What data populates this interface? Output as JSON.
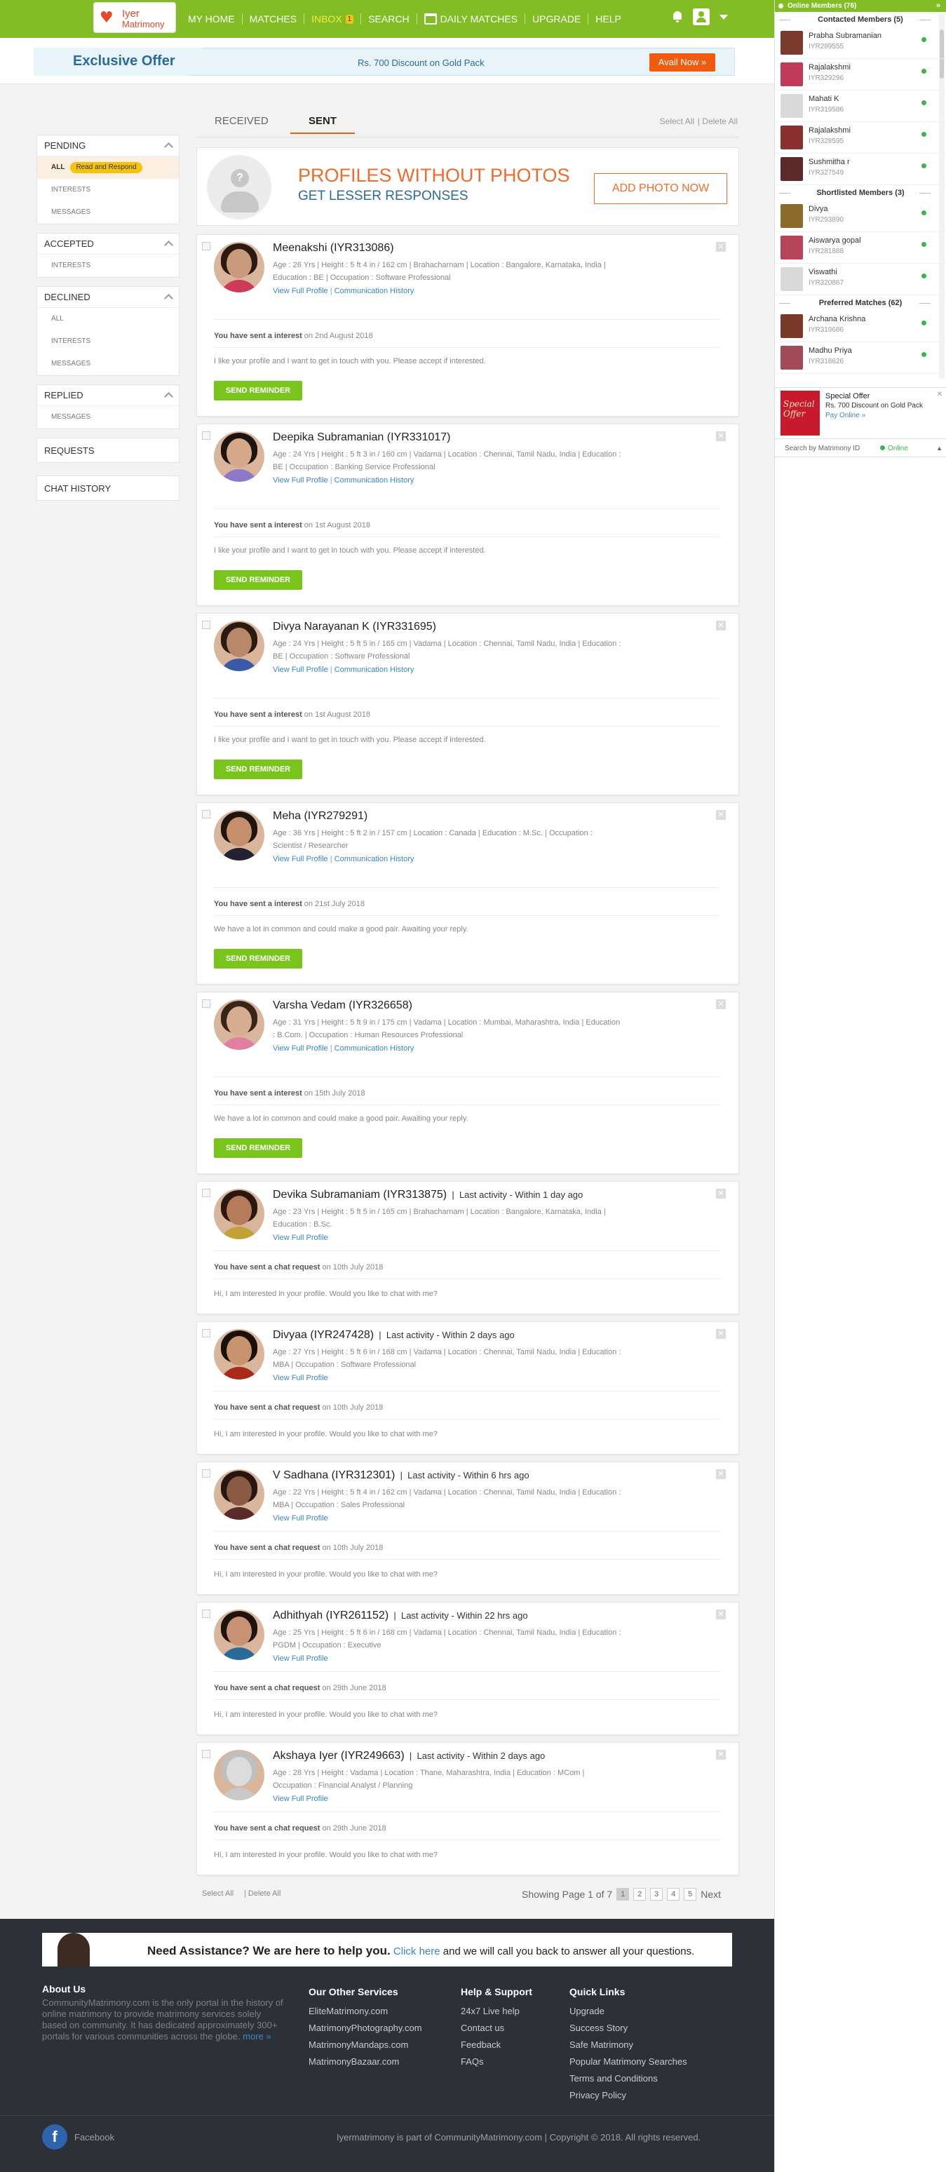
{
  "brand": {
    "line1": "Iyer",
    "line2": "Matrimony"
  },
  "nav": [
    {
      "label": "MY HOME"
    },
    {
      "label": "MATCHES"
    },
    {
      "label": "INBOX",
      "badge": "1"
    },
    {
      "label": "SEARCH"
    },
    {
      "label": "DAILY MATCHES"
    },
    {
      "label": "UPGRADE"
    },
    {
      "label": "HELP"
    }
  ],
  "offer": {
    "title": "Exclusive Offer",
    "text": "Rs. 700 Discount on Gold Pack",
    "button": "Avail Now »"
  },
  "tabs": {
    "received": "RECEIVED",
    "sent": "SENT",
    "select_all": "Select All",
    "delete_all": "| Delete All"
  },
  "sidebar": {
    "pending": {
      "title": "PENDING",
      "all": "ALL",
      "pill": "Read and Respond",
      "interests": "INTERESTS",
      "messages": "MESSAGES"
    },
    "accepted": {
      "title": "ACCEPTED",
      "interests": "INTERESTS"
    },
    "declined": {
      "title": "DECLINED",
      "all": "ALL",
      "interests": "INTERESTS",
      "messages": "MESSAGES"
    },
    "replied": {
      "title": "REPLIED",
      "messages": "MESSAGES"
    },
    "requests": "REQUESTS",
    "chat_history": "CHAT HISTORY"
  },
  "nophoto": {
    "headline": "PROFILES WITHOUT PHOTOS",
    "sub": "GET LESSER RESPONSES",
    "button": "ADD PHOTO NOW"
  },
  "cards": [
    {
      "name": "Meenakshi (IYR313086)",
      "activity": "",
      "details": "Age : 26 Yrs | Height : 5 ft 4 in / 162 cm | Brahacharnam | Location : Bangalore, Karnataka, India | Education : BE | Occupation : Software Professional",
      "links": "View Full Profile",
      "links2": "Communication History",
      "sent_label": "You have sent a interest",
      "sent_date": " on 2nd August 2018",
      "message": "I like your profile and I want to get in touch with you. Please accept if interested.",
      "button": "SEND REMINDER"
    },
    {
      "name": "Deepika Subramanian (IYR331017)",
      "activity": "",
      "details": "Age : 24 Yrs | Height : 5 ft 3 in / 160 cm | Vadama | Location : Chennai, Tamil Nadu, India | Education : BE | Occupation : Banking Service Professional",
      "links": "View Full Profile",
      "links2": "Communication History",
      "sent_label": "You have sent a interest",
      "sent_date": " on 1st August 2018",
      "message": "I like your profile and I want to get in touch with you. Please accept if interested.",
      "button": "SEND REMINDER"
    },
    {
      "name": "Divya Narayanan K (IYR331695)",
      "activity": "",
      "details": "Age : 24 Yrs | Height : 5 ft 5 in / 165 cm | Vadama | Location : Chennai, Tamil Nadu, India | Education : BE | Occupation : Software Professional",
      "links": "View Full Profile",
      "links2": "Communication History",
      "sent_label": "You have sent a interest",
      "sent_date": " on 1st August 2018",
      "message": "I like your profile and I want to get in touch with you. Please accept if interested.",
      "button": "SEND REMINDER"
    },
    {
      "name": "Meha (IYR279291)",
      "activity": "",
      "details": "Age : 36 Yrs | Height : 5 ft 2 in / 157 cm | Location : Canada | Education : M.Sc. | Occupation : Scientist / Researcher",
      "links": "View Full Profile",
      "links2": "Communication History",
      "sent_label": "You have sent a interest",
      "sent_date": " on 21st July 2018",
      "message": "We have a lot in common and could make a good pair. Awaiting your reply.",
      "button": "SEND REMINDER"
    },
    {
      "name": "Varsha Vedam (IYR326658)",
      "activity": "",
      "details": "Age : 31 Yrs | Height : 5 ft 9 in / 175 cm | Vadama | Location : Mumbai, Maharashtra, India | Education : B.Com. | Occupation : Human Resources Professional",
      "links": "View Full Profile",
      "links2": "Communication History",
      "sent_label": "You have sent a interest",
      "sent_date": " on 15th July 2018",
      "message": "We have a lot in common and could make a good pair. Awaiting your reply.",
      "button": "SEND REMINDER"
    },
    {
      "name": "Devika Subramaniam (IYR313875)",
      "activity": "Last activity - Within 1 day ago",
      "details": "Age : 23 Yrs | Height : 5 ft 5 in / 165 cm | Brahacharnam | Location : Bangalore, Karnataka, India | Education : B.Sc.",
      "links": "View Full Profile",
      "links2": "",
      "sent_label": "You have sent a chat request",
      "sent_date": " on 10th July 2018",
      "message": "Hi, I am interested in your profile. Would you like to chat with me?",
      "button": ""
    },
    {
      "name": "Divyaa (IYR247428)",
      "activity": "Last activity - Within 2 days ago",
      "details": "Age : 27 Yrs | Height : 5 ft 6 in / 168 cm | Vadama | Location : Chennai, Tamil Nadu, India | Education : MBA | Occupation : Software Professional",
      "links": "View Full Profile",
      "links2": "",
      "sent_label": "You have sent a chat request",
      "sent_date": " on 10th July 2018",
      "message": "Hi, I am interested in your profile. Would you like to chat with me?",
      "button": ""
    },
    {
      "name": "V Sadhana (IYR312301)",
      "activity": "Last activity - Within 6 hrs ago",
      "details": "Age : 22 Yrs | Height : 5 ft 4 in / 162 cm | Vadama | Location : Chennai, Tamil Nadu, India | Education : MBA | Occupation : Sales Professional",
      "links": "View Full Profile",
      "links2": "",
      "sent_label": "You have sent a chat request",
      "sent_date": " on 10th July 2018",
      "message": "Hi, I am interested in your profile. Would you like to chat with me?",
      "button": ""
    },
    {
      "name": "Adhithyah (IYR261152)",
      "activity": "Last activity - Within 22 hrs ago",
      "details": "Age : 25 Yrs | Height : 5 ft 6 in / 168 cm | Vadama | Location : Chennai, Tamil Nadu, India | Education : PGDM | Occupation : Executive",
      "links": "View Full Profile",
      "links2": "",
      "sent_label": "You have sent a chat request",
      "sent_date": " on 29th June 2018",
      "message": "Hi, I am interested in your profile. Would you like to chat with me?",
      "button": ""
    },
    {
      "name": "Akshaya Iyer (IYR249663)",
      "activity": "Last activity - Within 2 days ago",
      "details": "Age : 28 Yrs | Height : Vadama | Location : Thane, Maharashtra, India | Education : MCom | Occupation : Financial Analyst / Planning",
      "links": "View Full Profile",
      "links2": "",
      "sent_label": "You have sent a chat request",
      "sent_date": " on 29th June 2018",
      "message": "Hi, I am interested in your profile. Would you like to chat with me?",
      "button": ""
    }
  ],
  "pagination": {
    "select_all": "Select All",
    "delete_all": "| Delete All",
    "showing": "Showing Page 1 of 7",
    "pages": [
      "1",
      "2",
      "3",
      "4",
      "5"
    ],
    "next": "Next"
  },
  "assist": {
    "title": "Need Assistance? We are here to help you.",
    "click": "Click here",
    "rest": " and we will call you back to answer all your questions."
  },
  "footer": {
    "about_title": "About Us",
    "about_text": "CommunityMatrimony.com is the only portal in the history of online matrimony to provide matrimony services solely based on community. It has dedicated approximately 300+ portals for various communities across the globe.",
    "more": "more »",
    "services_title": "Our Other Services",
    "services": [
      "EliteMatrimony.com",
      "MatrimonyPhotography.com",
      "MatrimonyMandaps.com",
      "MatrimonyBazaar.com"
    ],
    "help_title": "Help & Support",
    "help": [
      "24x7 Live help",
      "Contact us",
      "Feedback",
      "FAQs"
    ],
    "quick_title": "Quick Links",
    "quick": [
      "Upgrade",
      "Success Story",
      "Safe Matrimony",
      "Popular Matrimony Searches",
      "Terms and Conditions",
      "Privacy Policy"
    ],
    "facebook": "Facebook",
    "copyright": "Iyermatrimony is part of CommunityMatrimony.com | Copyright © 2018. All rights reserved."
  },
  "online": {
    "header": "Online Members (76)",
    "contacted_title": "Contacted Members (5)",
    "contacted": [
      {
        "name": "Prabha Subramanian",
        "id": "IYR289555"
      },
      {
        "name": "Rajalakshmi",
        "id": "IYR329296"
      },
      {
        "name": "Mahati K",
        "id": "IYR319586"
      },
      {
        "name": "Rajalakshmi",
        "id": "IYR328595"
      },
      {
        "name": "Sushmitha r",
        "id": "IYR327549"
      }
    ],
    "shortlisted_title": "Shortlisted Members (3)",
    "shortlisted": [
      {
        "name": "Divya",
        "id": "IYR293890"
      },
      {
        "name": "Aiswarya gopal",
        "id": "IYR281888"
      },
      {
        "name": "Viswathi",
        "id": "IYR320867"
      }
    ],
    "preferred_title": "Preferred Matches (62)",
    "preferred": [
      {
        "name": "Archana Krishna",
        "id": "IYR319686"
      },
      {
        "name": "Madhu Priya",
        "id": "IYR318626"
      }
    ],
    "special_title": "Special Offer",
    "special_text": "Rs. 700 Discount on Gold Pack",
    "special_link": "Pay Online »",
    "special_img_text": "Special Offer",
    "search": "Search by Matrimony ID",
    "status": "Online"
  }
}
